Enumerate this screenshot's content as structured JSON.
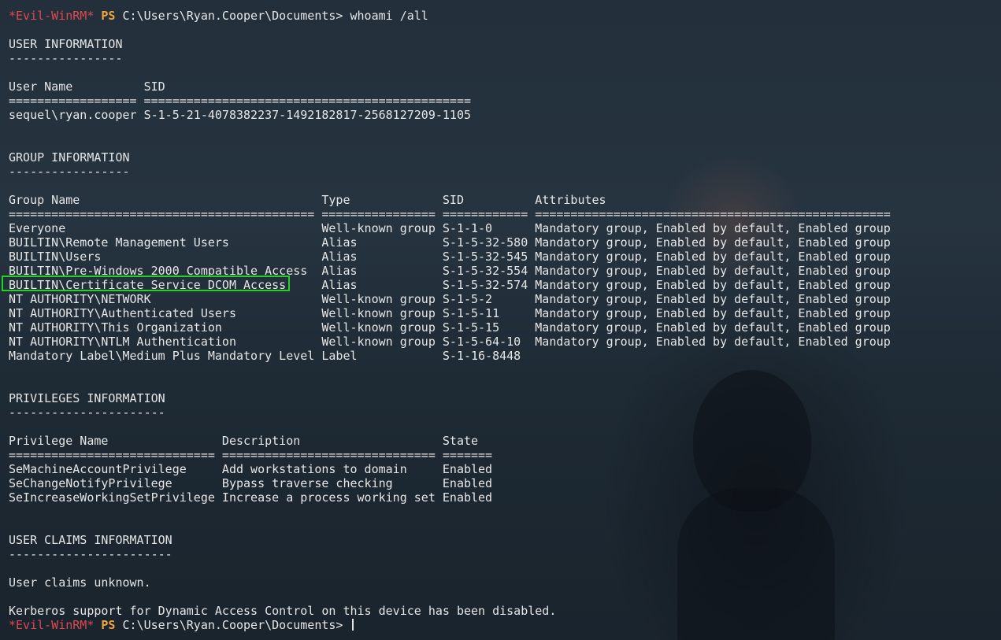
{
  "prompt": {
    "tag": "*Evil-WinRM*",
    "ps": "PS",
    "path": "C:\\Users\\Ryan.Cooper\\Documents>",
    "command": "whoami /all"
  },
  "lines": [
    "",
    "USER INFORMATION",
    "----------------",
    "",
    "User Name          SID",
    "================== ==============================================",
    "sequel\\ryan.cooper S-1-5-21-4078382237-1492182817-2568127209-1105",
    "",
    "",
    "GROUP INFORMATION",
    "-----------------",
    "",
    "Group Name                                  Type             SID          Attributes",
    "=========================================== ================ ============ ==================================================",
    "Everyone                                    Well-known group S-1-1-0      Mandatory group, Enabled by default, Enabled group",
    "BUILTIN\\Remote Management Users             Alias            S-1-5-32-580 Mandatory group, Enabled by default, Enabled group",
    "BUILTIN\\Users                               Alias            S-1-5-32-545 Mandatory group, Enabled by default, Enabled group",
    "BUILTIN\\Pre-Windows 2000 Compatible Access  Alias            S-1-5-32-554 Mandatory group, Enabled by default, Enabled group",
    "BUILTIN\\Certificate Service DCOM Access     Alias            S-1-5-32-574 Mandatory group, Enabled by default, Enabled group",
    "NT AUTHORITY\\NETWORK                        Well-known group S-1-5-2      Mandatory group, Enabled by default, Enabled group",
    "NT AUTHORITY\\Authenticated Users            Well-known group S-1-5-11     Mandatory group, Enabled by default, Enabled group",
    "NT AUTHORITY\\This Organization              Well-known group S-1-5-15     Mandatory group, Enabled by default, Enabled group",
    "NT AUTHORITY\\NTLM Authentication            Well-known group S-1-5-64-10  Mandatory group, Enabled by default, Enabled group",
    "Mandatory Label\\Medium Plus Mandatory Level Label            S-1-16-8448",
    "",
    "",
    "PRIVILEGES INFORMATION",
    "----------------------",
    "",
    "Privilege Name                Description                    State",
    "============================= ============================== =======",
    "SeMachineAccountPrivilege     Add workstations to domain     Enabled",
    "SeChangeNotifyPrivilege       Bypass traverse checking       Enabled",
    "SeIncreaseWorkingSetPrivilege Increase a process working set Enabled",
    "",
    "",
    "USER CLAIMS INFORMATION",
    "-----------------------",
    "",
    "User claims unknown.",
    "",
    "Kerberos support for Dynamic Access Control on this device has been disabled."
  ],
  "colors": {
    "prompt_tag": "#e0484f",
    "prompt_ps": "#f0a33a",
    "highlight": "#22d322"
  }
}
